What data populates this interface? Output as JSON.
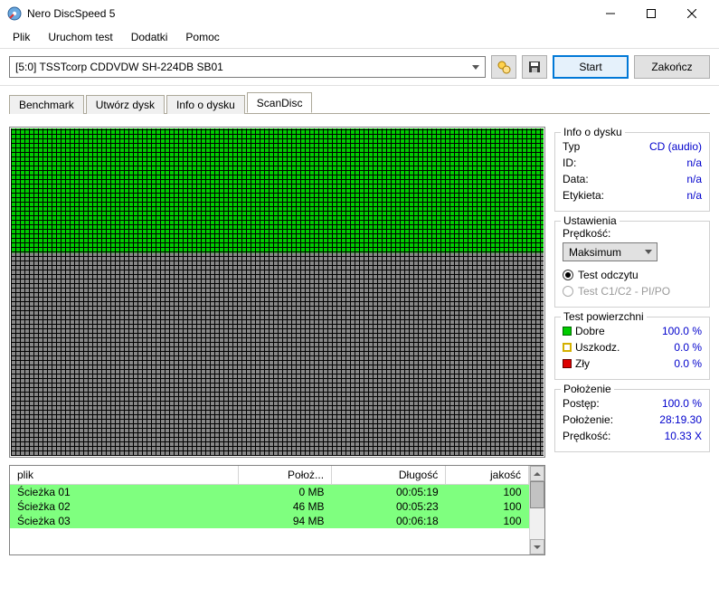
{
  "window": {
    "title": "Nero DiscSpeed 5"
  },
  "menu": {
    "file": "Plik",
    "run_test": "Uruchom test",
    "extras": "Dodatki",
    "help": "Pomoc"
  },
  "toolbar": {
    "drive_label": "[5:0]   TSSTcorp CDDVDW SH-224DB SB01",
    "start_label": "Start",
    "end_label": "Zakończ"
  },
  "tabs": {
    "benchmark": "Benchmark",
    "create": "Utwórz dysk",
    "info": "Info o dysku",
    "scandisc": "ScanDisc"
  },
  "disc_info": {
    "legend": "Info o dysku",
    "type_k": "Typ",
    "type_v": "CD (audio)",
    "id_k": "ID:",
    "id_v": "n/a",
    "date_k": "Data:",
    "date_v": "n/a",
    "label_k": "Etykieta:",
    "label_v": "n/a"
  },
  "settings": {
    "legend": "Ustawienia",
    "speed_k": "Prędkość:",
    "speed_v": "Maksimum",
    "read_test": "Test odczytu",
    "c1c2_test": "Test C1/C2 - PI/PO"
  },
  "surface": {
    "legend": "Test powierzchni",
    "good_k": "Dobre",
    "good_v": "100.0 %",
    "dmg_k": "Uszkodz.",
    "dmg_v": "0.0 %",
    "bad_k": "Zły",
    "bad_v": "0.0 %"
  },
  "position": {
    "legend": "Położenie",
    "prog_k": "Postęp:",
    "prog_v": "100.0 %",
    "pos_k": "Położenie:",
    "pos_v": "28:19.30",
    "spd_k": "Prędkość:",
    "spd_v": "10.33 X"
  },
  "table": {
    "h_file": "plik",
    "h_pos": "Położ...",
    "h_len": "Długość",
    "h_qual": "jakość",
    "rows": [
      {
        "file": "Ścieżka 01",
        "pos": "0 MB",
        "len": "00:05:19",
        "qual": "100"
      },
      {
        "file": "Ścieżka 02",
        "pos": "46 MB",
        "len": "00:05:23",
        "qual": "100"
      },
      {
        "file": "Ścieżka 03",
        "pos": "94 MB",
        "len": "00:06:18",
        "qual": "100"
      }
    ]
  }
}
